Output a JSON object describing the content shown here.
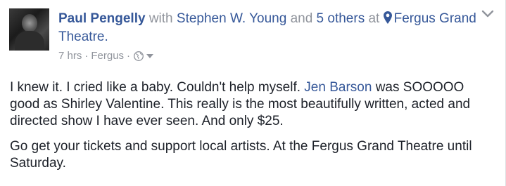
{
  "post": {
    "author": "Paul Pengelly",
    "with_word": "with",
    "tagged_person": "Stephen W. Young",
    "and_word": "and",
    "others": "5 others",
    "at_word": "at",
    "location": "Fergus Grand Theatre.",
    "time": "7 hrs",
    "place": "Fergus",
    "separator": "·",
    "paragraph1_part1": "I knew it. I cried like a baby. Couldn't help myself. ",
    "mention": "Jen Barson",
    "paragraph1_part2": " was SOOOOO good as Shirley Valentine. This really is the most beautifully written, acted and directed show I have ever seen. And only $25.",
    "paragraph2": "Go get your tickets and support local artists. At the Fergus Grand Theatre until Saturday."
  },
  "icons": {
    "location": "map-pin-icon",
    "privacy": "globe-icon",
    "privacy_menu": "caret-down-icon",
    "post_menu": "chevron-down-icon"
  },
  "colors": {
    "link": "#365899",
    "muted": "#90949c",
    "text": "#1d2129"
  }
}
